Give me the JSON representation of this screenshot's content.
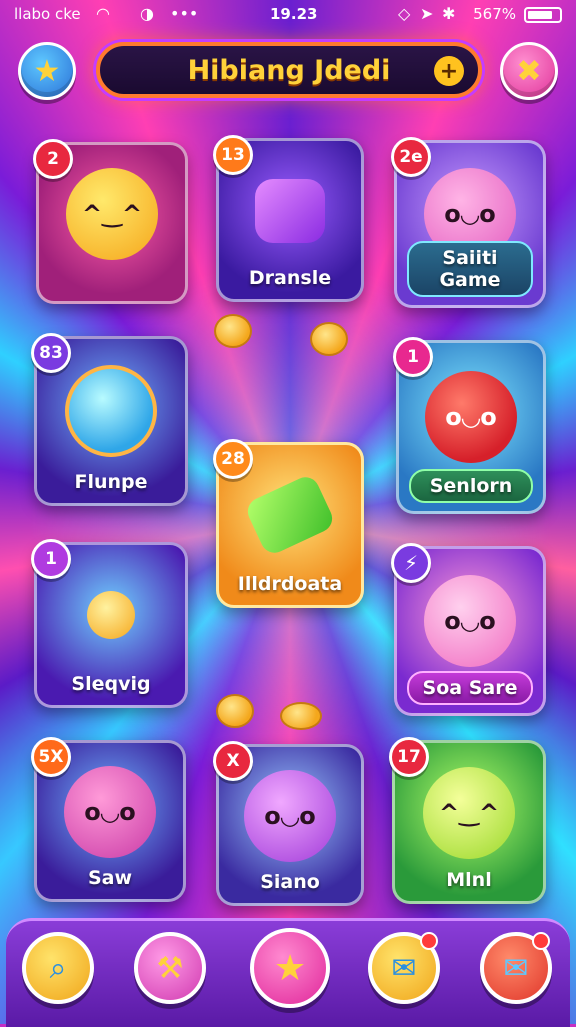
{
  "status_bar": {
    "carrier": "llabo cke",
    "time": "19.23",
    "battery_text": "567%"
  },
  "header": {
    "title": "Hibiang Jdedi",
    "left_button_icon": "star-icon",
    "right_button_icon": "close-icon",
    "plus_icon": "plus-icon"
  },
  "tiles": [
    {
      "badge": "2",
      "label": "",
      "icon": "yellow-smiley-character"
    },
    {
      "badge": "13",
      "label": "Dransle",
      "icon": "purple-gem"
    },
    {
      "badge": "2e",
      "label": "Saiiti Game",
      "icon": "pink-monster-character"
    },
    {
      "badge": "83",
      "label": "Flunpe",
      "icon": "globe-orb"
    },
    {
      "badge": "1",
      "label": "Senlorn",
      "icon": "red-sun-character"
    },
    {
      "badge": "28",
      "label": "Illdrdoata",
      "icon": "green-hammer"
    },
    {
      "badge": "1",
      "label": "Sleqvig",
      "icon": "golden-orb"
    },
    {
      "badge": "",
      "label": "Soa Sare",
      "icon": "pink-monster-character"
    },
    {
      "badge": "5X",
      "label": "Saw",
      "icon": "pink-monster-character"
    },
    {
      "badge": "X",
      "label": "Siano",
      "icon": "purple-monster-character"
    },
    {
      "badge": "17",
      "label": "Mlnl",
      "icon": "lime-smiley-character"
    }
  ],
  "bottom_nav": [
    {
      "icon": "search-icon"
    },
    {
      "icon": "tools-icon"
    },
    {
      "icon": "star-icon"
    },
    {
      "icon": "chat-icon",
      "notification": true
    },
    {
      "icon": "message-icon",
      "notification": true
    }
  ],
  "colors": {
    "accent_gold": "#ffd23a",
    "title_border": "#ff7a2f",
    "nav_bar": "#7a2fc8"
  }
}
